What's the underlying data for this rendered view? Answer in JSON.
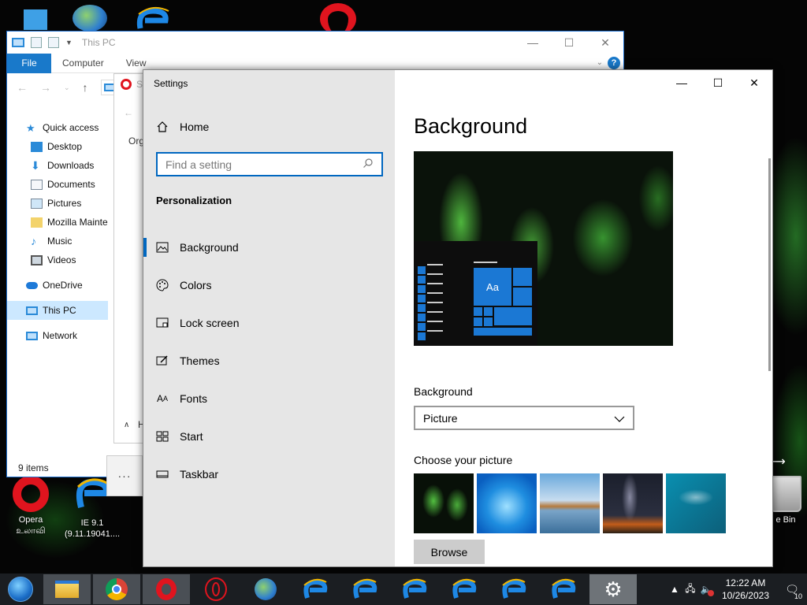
{
  "desktop": {
    "icons": [
      {
        "label": "Opera\nஉலாவி"
      },
      {
        "label": "IE 9.1\n(9.11.19041...."
      },
      {
        "label": "e Bin"
      }
    ]
  },
  "explorer": {
    "title": "This PC",
    "ribbon": {
      "file": "File",
      "computer": "Computer",
      "view": "View"
    },
    "help": "?",
    "tree": [
      "Quick access",
      "Desktop",
      "Downloads",
      "Documents",
      "Pictures",
      "Mozilla Mainte",
      "Music",
      "Videos",
      "OneDrive",
      "This PC",
      "Network"
    ],
    "status": "9 items"
  },
  "background_window": {
    "fragments": [
      "S",
      "Org",
      "H"
    ],
    "more": "···"
  },
  "settings": {
    "app_title": "Settings",
    "home": "Home",
    "search_placeholder": "Find a setting",
    "section": "Personalization",
    "nav": [
      "Background",
      "Colors",
      "Lock screen",
      "Themes",
      "Fonts",
      "Start",
      "Taskbar"
    ],
    "active_nav": "Background",
    "page_title": "Background",
    "preview_tile": "Aa",
    "background_label": "Background",
    "background_value": "Picture",
    "choose_label": "Choose your picture",
    "browse": "Browse"
  },
  "taskbar": {
    "clock_time": "12:22 AM",
    "clock_date": "10/26/2023",
    "notifications": "10"
  },
  "colors": {
    "accent": "#0067c0",
    "opera_red": "#e0141e",
    "ie_blue": "#1e88e5"
  }
}
